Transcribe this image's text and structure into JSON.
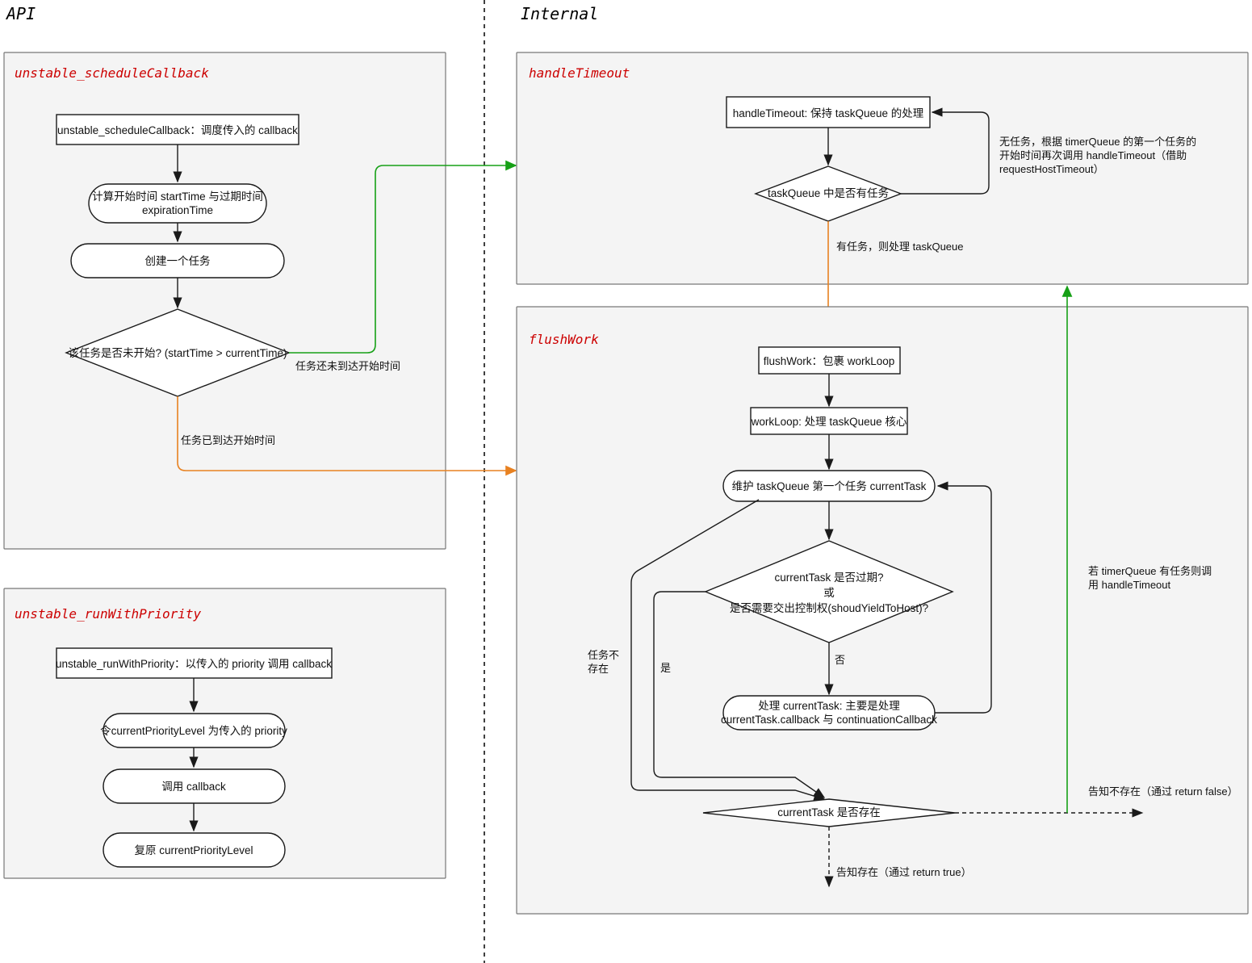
{
  "lanes": [
    {
      "id": "api",
      "title": "API"
    },
    {
      "id": "internal",
      "title": "Internal"
    }
  ],
  "groups": [
    {
      "id": "unstable_scheduleCallback",
      "title": "unstable_scheduleCallback"
    },
    {
      "id": "unstable_runWithPriority",
      "title": "unstable_runWithPriority"
    },
    {
      "id": "handleTimeout",
      "title": "handleTimeout"
    },
    {
      "id": "flushWork",
      "title": "flushWork"
    }
  ],
  "nodes": {
    "schedule_entry": "unstable_scheduleCallback：调度传入的 callback",
    "compute_time_l1": "计算开始时间 startTime 与过期时间",
    "compute_time_l2": "expirationTime",
    "create_task": "创建一个任务",
    "not_started_decision": "该任务是否未开始? (startTime > currentTime)",
    "runwith_entry": "unstable_runWithPriority：以传入的 priority 调用 callback",
    "set_priority": "令currentPriorityLevel 为传入的 priority",
    "call_callback": "调用 callback",
    "restore_priority": "复原 currentPriorityLevel",
    "handle_timeout_entry": "handleTimeout: 保持 taskQueue 的处理",
    "taskqueue_has_task_decision": "taskQueue 中是否有任务",
    "flushwork_entry": "flushWork：包裹 workLoop",
    "workloop": "workLoop: 处理 taskQueue 核心",
    "maintain_current_task": "维护 taskQueue 第一个任务 currentTask",
    "expired_decision_l1": "currentTask 是否过期?",
    "expired_decision_l2": "或",
    "expired_decision_l3": "是否需要交出控制权(shoudYieldToHost)?",
    "process_task_l1": "处理 currentTask: 主要是处理",
    "process_task_l2": "currentTask.callback 与 continuationCallback",
    "current_task_exists_decision": "currentTask 是否存在"
  },
  "edge_labels": {
    "not_arrived": "任务还未到达开始时间",
    "arrived": "任务已到达开始时间",
    "no_task_reschedule_l1": "无任务，根据 timerQueue 的第一个任务的",
    "no_task_reschedule_l2": "开始时间再次调用 handleTimeout（借助",
    "no_task_reschedule_l3": "requestHostTimeout）",
    "has_task_process": "有任务，则处理 taskQueue",
    "task_not_exist_l1": "任务不",
    "task_not_exist_l2": "存在",
    "yes": "是",
    "no": "否",
    "timerqueue_call_l1": "若 timerQueue 有任务则调",
    "timerqueue_call_l2": "用 handleTimeout",
    "notify_absent": "告知不存在（通过 return false）",
    "notify_present": "告知存在（通过 return true）"
  },
  "colors": {
    "panel_fill": "#f4f4f4",
    "panel_stroke": "#777777",
    "group_title": "#cc0000",
    "green_edge": "#16a016",
    "orange_edge": "#e88120",
    "node_stroke": "#1a1a1a"
  }
}
